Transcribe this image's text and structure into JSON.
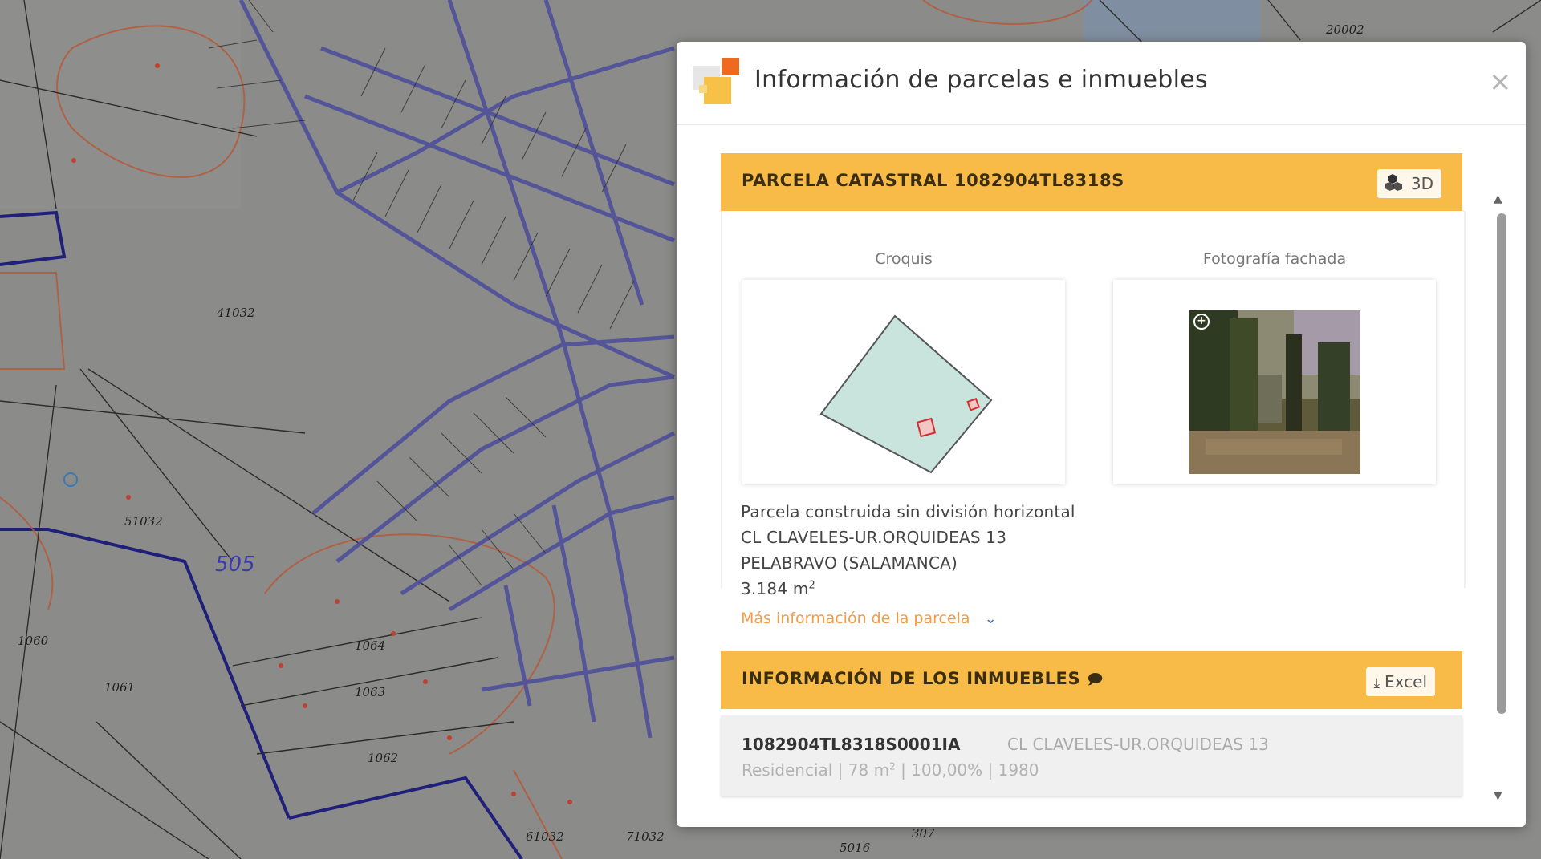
{
  "map": {
    "labels": [
      "41032",
      "51032",
      "505",
      "1064",
      "1063",
      "1062",
      "1061",
      "1060",
      "61032",
      "71032",
      "20002",
      "5016",
      "307"
    ]
  },
  "dialog": {
    "title": "Información de parcelas e inmuebles",
    "close_label": "×",
    "parcel_section": {
      "title": "PARCELA CATASTRAL 1082904TL8318S",
      "button_3d": "3D",
      "sketch_label": "Croquis",
      "photo_label": "Fotografía fachada",
      "description": "Parcela construida sin división horizontal",
      "address": "CL CLAVELES-UR.ORQUIDEAS 13",
      "municipality": "PELABRAVO (SALAMANCA)",
      "area_value": "3.184 m",
      "area_unit_sup": "2",
      "more_info": "Más información de la parcela"
    },
    "properties_section": {
      "title": "INFORMACIÓN DE LOS INMUEBLES",
      "excel_button": "Excel",
      "items": [
        {
          "reference": "1082904TL8318S0001IA",
          "address": "CL CLAVELES-UR.ORQUIDEAS 13",
          "use": "Residencial",
          "area": "78 m",
          "area_sup": "2",
          "participation": "100,00%",
          "year": "1980"
        }
      ]
    }
  },
  "colors": {
    "section_bar": "#f8bb47",
    "link": "#f39b45",
    "map_road": "#4f4f9a",
    "map_boundary": "#b85a3c",
    "parcel_fill": "#c9e4dc"
  },
  "icons": {
    "logo": "catastro-logo-icon",
    "cube": "cubes-3d-icon",
    "download": "download-icon",
    "comment": "comment-icon",
    "chevron": "chevron-down-icon",
    "zoom": "zoom-plus-icon"
  }
}
